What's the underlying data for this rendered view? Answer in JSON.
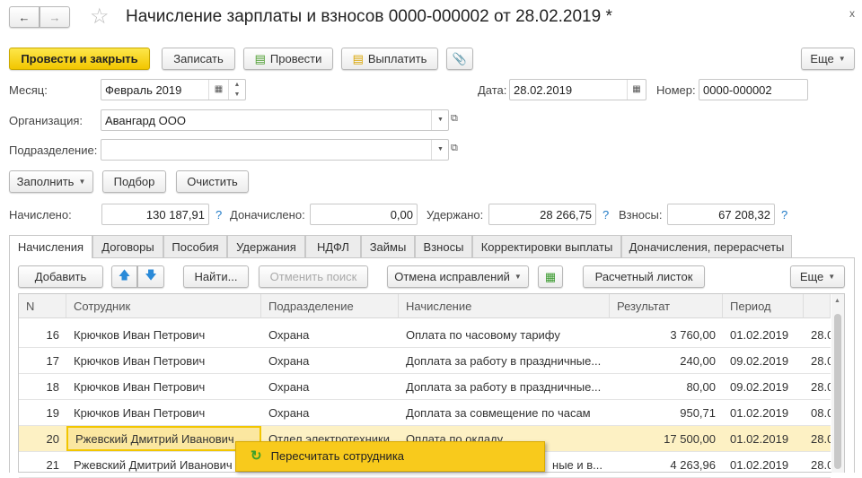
{
  "window": {
    "title": "Начисление зарплаты и взносов 0000-000002 от 28.02.2019 *",
    "close": "x"
  },
  "toolbar": {
    "post_close": "Провести и закрыть",
    "save": "Записать",
    "post": "Провести",
    "pay": "Выплатить",
    "more": "Еще"
  },
  "fields": {
    "month_label": "Месяц:",
    "month": "Февраль 2019",
    "date_label": "Дата:",
    "date": "28.02.2019",
    "number_label": "Номер:",
    "number": "0000-000002",
    "org_label": "Организация:",
    "org": "Авангард ООО",
    "dept_label": "Подразделение:",
    "dept": ""
  },
  "actions": {
    "fill": "Заполнить",
    "pick": "Подбор",
    "clear": "Очистить"
  },
  "totals": {
    "accrued_label": "Начислено:",
    "accrued": "130 187,91",
    "extra_label": "Доначислено:",
    "extra": "0,00",
    "withheld_label": "Удержано:",
    "withheld": "28 266,75",
    "contrib_label": "Взносы:",
    "contrib": "67 208,32",
    "help": "?"
  },
  "tabs": [
    "Начисления",
    "Договоры",
    "Пособия",
    "Удержания",
    "НДФЛ",
    "Займы",
    "Взносы",
    "Корректировки выплаты",
    "Доначисления, перерасчеты"
  ],
  "table_toolbar": {
    "add": "Добавить",
    "find": "Найти...",
    "cancel_search": "Отменить поиск",
    "undo_fix": "Отмена исправлений",
    "payslip": "Расчетный листок",
    "more": "Еще"
  },
  "table": {
    "columns": [
      "N",
      "Сотрудник",
      "Подразделение",
      "Начисление",
      "Результат",
      "Период",
      ""
    ],
    "rows": [
      {
        "n": "16",
        "emp": "Крючков Иван Петрович",
        "dept": "Охрана",
        "acc": "Оплата по часовому тарифу",
        "res": "3 760,00",
        "from": "01.02.2019",
        "to": "28.0"
      },
      {
        "n": "17",
        "emp": "Крючков Иван Петрович",
        "dept": "Охрана",
        "acc": "Доплата за работу в праздничные...",
        "res": "240,00",
        "from": "09.02.2019",
        "to": "28.0"
      },
      {
        "n": "18",
        "emp": "Крючков Иван Петрович",
        "dept": "Охрана",
        "acc": "Доплата за работу в праздничные...",
        "res": "80,00",
        "from": "09.02.2019",
        "to": "28.0"
      },
      {
        "n": "19",
        "emp": "Крючков Иван Петрович",
        "dept": "Охрана",
        "acc": "Доплата за совмещение по часам",
        "res": "950,71",
        "from": "01.02.2019",
        "to": "08.0"
      },
      {
        "n": "20",
        "emp": "Ржевский Дмитрий Иванович",
        "dept": "Отдел электротехники",
        "acc": "Оплата по окладу",
        "res": "17 500,00",
        "from": "01.02.2019",
        "to": "28.0"
      },
      {
        "n": "21",
        "emp": "Ржевский Дмитрий Иванович",
        "dept": "",
        "acc": "ные и в...",
        "res": "4 263,96",
        "from": "01.02.2019",
        "to": "28.0"
      }
    ]
  },
  "context_menu": {
    "recalc": "Пересчитать сотрудника"
  }
}
